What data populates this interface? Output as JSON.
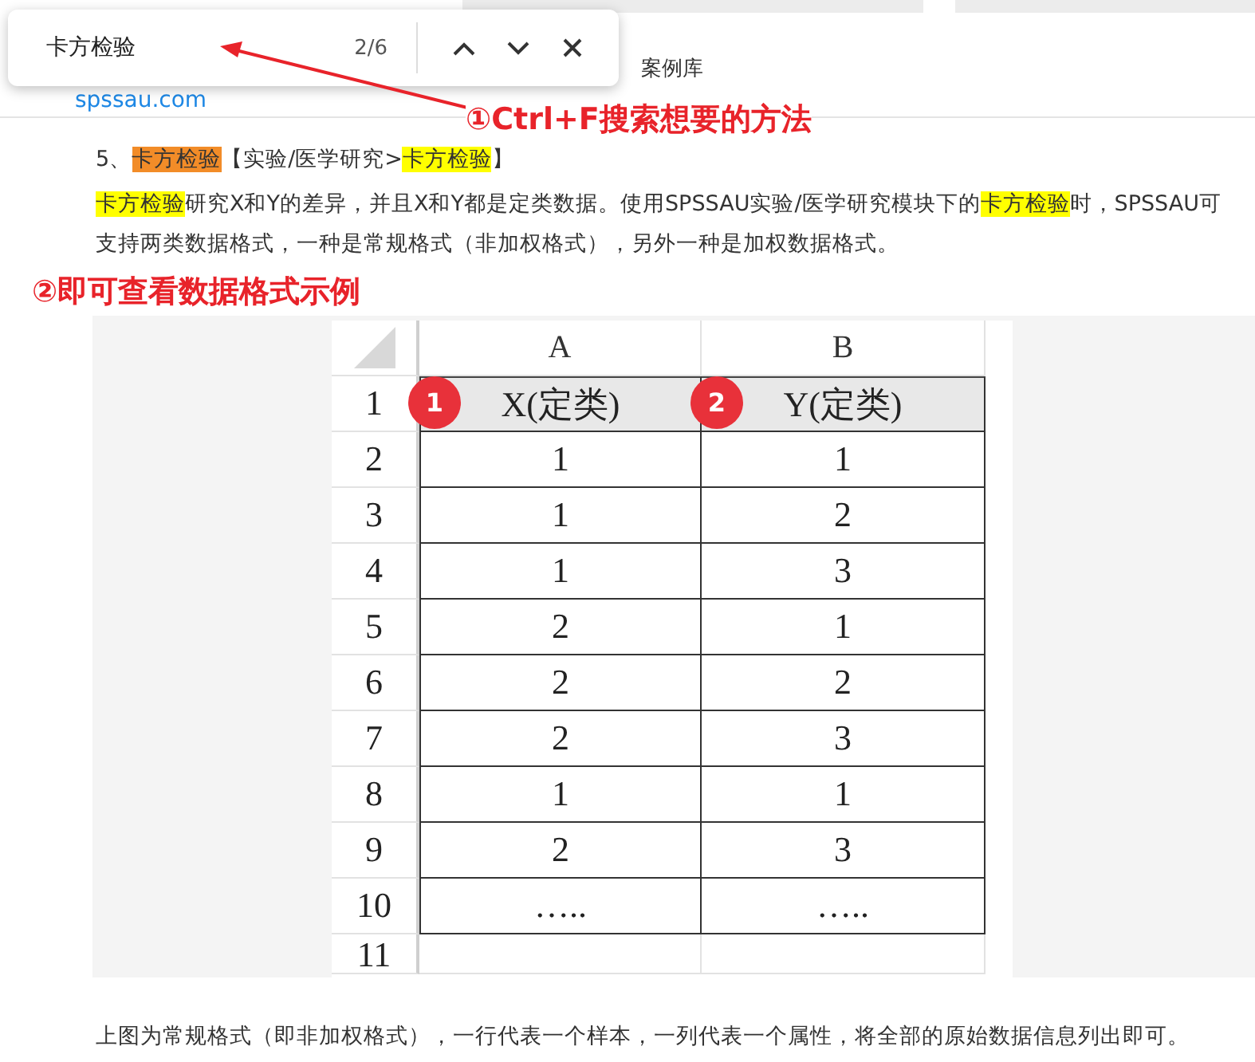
{
  "find_bar": {
    "query": "卡方检验",
    "match_count": "2/6"
  },
  "site_header": {
    "logo_link": "spssau.com",
    "nav_item": "案例库"
  },
  "annotations": [
    {
      "text": "①Ctrl+F搜索想要的方法"
    },
    {
      "text": "②即可查看数据格式示例"
    }
  ],
  "article": {
    "heading": [
      {
        "text": "5、",
        "highlighted": false,
        "current": false
      },
      {
        "text": "卡方检验",
        "highlighted": true,
        "current": true
      },
      {
        "text": "【实验/医学研究>",
        "highlighted": false,
        "current": false
      },
      {
        "text": "卡方检验",
        "highlighted": true,
        "current": false
      },
      {
        "text": "】",
        "highlighted": false,
        "current": false
      }
    ],
    "paragraph": [
      {
        "text": "卡方检验",
        "highlighted": true,
        "current": false
      },
      {
        "text": "研究X和Y的差异，并且X和Y都是定类数据。使用SPSSAU实验/医学研究模块下的",
        "highlighted": false,
        "current": false
      },
      {
        "text": "卡方检验",
        "highlighted": true,
        "current": false
      },
      {
        "text": "时，SPSSAU可支持两类数据格式，一种是常规格式（非加权格式），另外一种是加权数据格式。",
        "highlighted": false,
        "current": false
      }
    ],
    "caption": "上图为常规格式（即非加权格式），一行代表一个样本，一列代表一个属性，将全部的原始数据信息列出即可。"
  },
  "spreadsheet": {
    "columns": [
      "A",
      "B"
    ],
    "rows": [
      {
        "number": "1",
        "kind": "header",
        "cells": [
          "X(定类)",
          "Y(定类)"
        ]
      },
      {
        "number": "2",
        "kind": "data",
        "cells": [
          "1",
          "1"
        ]
      },
      {
        "number": "3",
        "kind": "data",
        "cells": [
          "1",
          "2"
        ]
      },
      {
        "number": "4",
        "kind": "data",
        "cells": [
          "1",
          "3"
        ]
      },
      {
        "number": "5",
        "kind": "data",
        "cells": [
          "2",
          "1"
        ]
      },
      {
        "number": "6",
        "kind": "data",
        "cells": [
          "2",
          "2"
        ]
      },
      {
        "number": "7",
        "kind": "data",
        "cells": [
          "2",
          "3"
        ]
      },
      {
        "number": "8",
        "kind": "data",
        "cells": [
          "1",
          "1"
        ]
      },
      {
        "number": "9",
        "kind": "data",
        "cells": [
          "2",
          "3"
        ]
      },
      {
        "number": "10",
        "kind": "data",
        "cells": [
          "…..",
          "….."
        ]
      },
      {
        "number": "11",
        "kind": "empty",
        "cells": []
      }
    ],
    "markers": [
      "1",
      "2"
    ]
  }
}
